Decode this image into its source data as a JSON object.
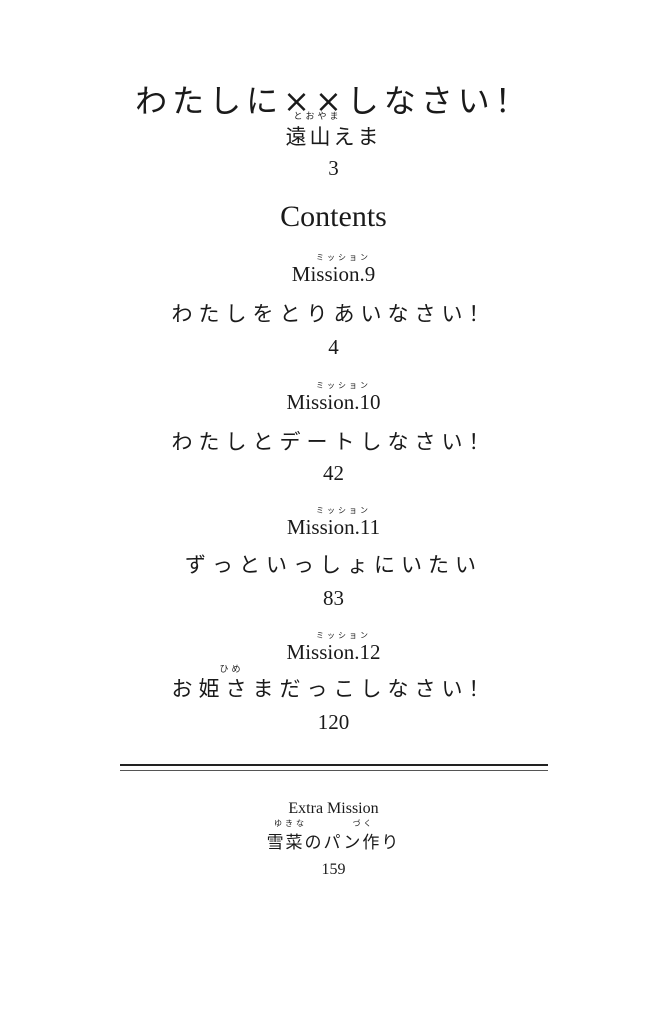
{
  "book": {
    "title": "わたしに××しなさい！",
    "author_ruby": "とおやま",
    "author": "遠山えま",
    "title_page": "3"
  },
  "contents_heading": "Contents",
  "chapters": [
    {
      "ruby": "ミッション",
      "mission": "Mission.9",
      "title": "わたしをとりあいなさい！",
      "page": "4"
    },
    {
      "ruby": "ミッション",
      "mission": "Mission.10",
      "title": "わたしとデートしなさい！",
      "page": "42"
    },
    {
      "ruby": "ミッション",
      "mission": "Mission.11",
      "title": "ずっといっしょにいたい",
      "page": "83"
    },
    {
      "ruby": "ミッション",
      "mission": "Mission.12",
      "title_ruby": "ひめ",
      "title": "お姫さまだっこしなさい！",
      "page": "120"
    }
  ],
  "extra": {
    "label": "Extra Mission",
    "title_ruby_1": "ゆきな",
    "title_ruby_2": "づく",
    "title": "雪菜のパン作り",
    "page": "159"
  }
}
